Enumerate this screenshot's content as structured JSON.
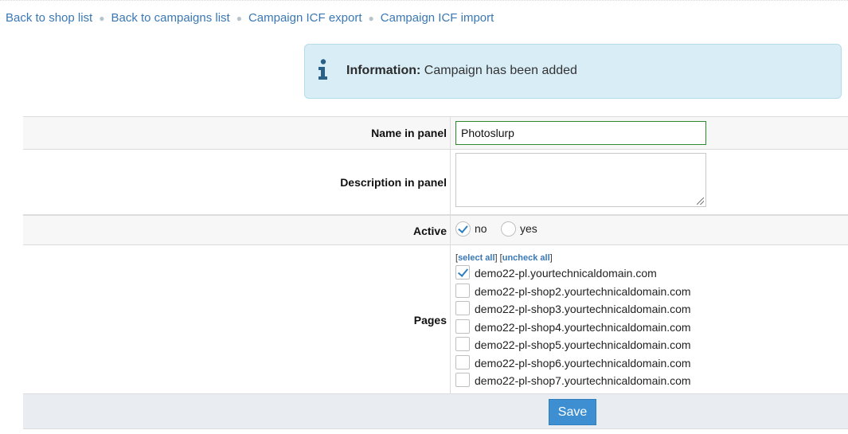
{
  "breadcrumb": [
    {
      "label": "Back to shop list"
    },
    {
      "label": "Back to campaigns list"
    },
    {
      "label": "Campaign ICF export"
    },
    {
      "label": "Campaign ICF import"
    }
  ],
  "info": {
    "label": "Information:",
    "message": "Campaign has been added",
    "icon": "info-icon",
    "color": "#d9edf7"
  },
  "form": {
    "name_label": "Name in panel",
    "name_value": "Photoslurp",
    "description_label": "Description in panel",
    "description_value": "",
    "active_label": "Active",
    "active_options": [
      {
        "label": "no",
        "checked": true
      },
      {
        "label": "yes",
        "checked": false
      }
    ],
    "pages_label": "Pages",
    "select_all": "select all",
    "uncheck_all": "uncheck all",
    "pages": [
      {
        "label": "demo22-pl.yourtechnicaldomain.com",
        "checked": true
      },
      {
        "label": "demo22-pl-shop2.yourtechnicaldomain.com",
        "checked": false
      },
      {
        "label": "demo22-pl-shop3.yourtechnicaldomain.com",
        "checked": false
      },
      {
        "label": "demo22-pl-shop4.yourtechnicaldomain.com",
        "checked": false
      },
      {
        "label": "demo22-pl-shop5.yourtechnicaldomain.com",
        "checked": false
      },
      {
        "label": "demo22-pl-shop6.yourtechnicaldomain.com",
        "checked": false
      },
      {
        "label": "demo22-pl-shop7.yourtechnicaldomain.com",
        "checked": false
      }
    ],
    "save_label": "Save"
  }
}
